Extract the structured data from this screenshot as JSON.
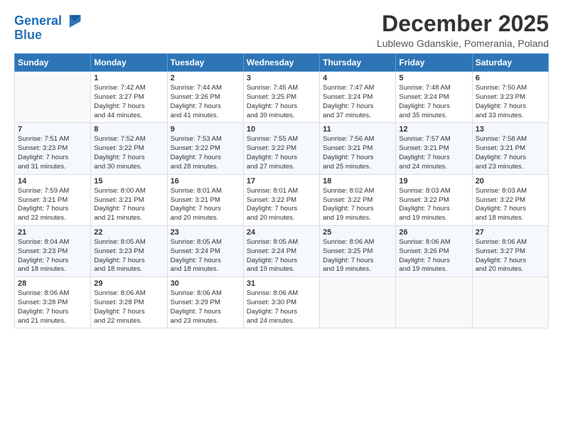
{
  "header": {
    "logo_line1": "General",
    "logo_line2": "Blue",
    "month": "December 2025",
    "location": "Lublewo Gdanskie, Pomerania, Poland"
  },
  "days_of_week": [
    "Sunday",
    "Monday",
    "Tuesday",
    "Wednesday",
    "Thursday",
    "Friday",
    "Saturday"
  ],
  "weeks": [
    [
      {
        "day": "",
        "info": ""
      },
      {
        "day": "1",
        "info": "Sunrise: 7:42 AM\nSunset: 3:27 PM\nDaylight: 7 hours\nand 44 minutes."
      },
      {
        "day": "2",
        "info": "Sunrise: 7:44 AM\nSunset: 3:26 PM\nDaylight: 7 hours\nand 41 minutes."
      },
      {
        "day": "3",
        "info": "Sunrise: 7:45 AM\nSunset: 3:25 PM\nDaylight: 7 hours\nand 39 minutes."
      },
      {
        "day": "4",
        "info": "Sunrise: 7:47 AM\nSunset: 3:24 PM\nDaylight: 7 hours\nand 37 minutes."
      },
      {
        "day": "5",
        "info": "Sunrise: 7:48 AM\nSunset: 3:24 PM\nDaylight: 7 hours\nand 35 minutes."
      },
      {
        "day": "6",
        "info": "Sunrise: 7:50 AM\nSunset: 3:23 PM\nDaylight: 7 hours\nand 33 minutes."
      }
    ],
    [
      {
        "day": "7",
        "info": "Sunrise: 7:51 AM\nSunset: 3:23 PM\nDaylight: 7 hours\nand 31 minutes."
      },
      {
        "day": "8",
        "info": "Sunrise: 7:52 AM\nSunset: 3:22 PM\nDaylight: 7 hours\nand 30 minutes."
      },
      {
        "day": "9",
        "info": "Sunrise: 7:53 AM\nSunset: 3:22 PM\nDaylight: 7 hours\nand 28 minutes."
      },
      {
        "day": "10",
        "info": "Sunrise: 7:55 AM\nSunset: 3:22 PM\nDaylight: 7 hours\nand 27 minutes."
      },
      {
        "day": "11",
        "info": "Sunrise: 7:56 AM\nSunset: 3:21 PM\nDaylight: 7 hours\nand 25 minutes."
      },
      {
        "day": "12",
        "info": "Sunrise: 7:57 AM\nSunset: 3:21 PM\nDaylight: 7 hours\nand 24 minutes."
      },
      {
        "day": "13",
        "info": "Sunrise: 7:58 AM\nSunset: 3:21 PM\nDaylight: 7 hours\nand 23 minutes."
      }
    ],
    [
      {
        "day": "14",
        "info": "Sunrise: 7:59 AM\nSunset: 3:21 PM\nDaylight: 7 hours\nand 22 minutes."
      },
      {
        "day": "15",
        "info": "Sunrise: 8:00 AM\nSunset: 3:21 PM\nDaylight: 7 hours\nand 21 minutes."
      },
      {
        "day": "16",
        "info": "Sunrise: 8:01 AM\nSunset: 3:21 PM\nDaylight: 7 hours\nand 20 minutes."
      },
      {
        "day": "17",
        "info": "Sunrise: 8:01 AM\nSunset: 3:22 PM\nDaylight: 7 hours\nand 20 minutes."
      },
      {
        "day": "18",
        "info": "Sunrise: 8:02 AM\nSunset: 3:22 PM\nDaylight: 7 hours\nand 19 minutes."
      },
      {
        "day": "19",
        "info": "Sunrise: 8:03 AM\nSunset: 3:22 PM\nDaylight: 7 hours\nand 19 minutes."
      },
      {
        "day": "20",
        "info": "Sunrise: 8:03 AM\nSunset: 3:22 PM\nDaylight: 7 hours\nand 18 minutes."
      }
    ],
    [
      {
        "day": "21",
        "info": "Sunrise: 8:04 AM\nSunset: 3:23 PM\nDaylight: 7 hours\nand 18 minutes."
      },
      {
        "day": "22",
        "info": "Sunrise: 8:05 AM\nSunset: 3:23 PM\nDaylight: 7 hours\nand 18 minutes."
      },
      {
        "day": "23",
        "info": "Sunrise: 8:05 AM\nSunset: 3:24 PM\nDaylight: 7 hours\nand 18 minutes."
      },
      {
        "day": "24",
        "info": "Sunrise: 8:05 AM\nSunset: 3:24 PM\nDaylight: 7 hours\nand 19 minutes."
      },
      {
        "day": "25",
        "info": "Sunrise: 8:06 AM\nSunset: 3:25 PM\nDaylight: 7 hours\nand 19 minutes."
      },
      {
        "day": "26",
        "info": "Sunrise: 8:06 AM\nSunset: 3:26 PM\nDaylight: 7 hours\nand 19 minutes."
      },
      {
        "day": "27",
        "info": "Sunrise: 8:06 AM\nSunset: 3:27 PM\nDaylight: 7 hours\nand 20 minutes."
      }
    ],
    [
      {
        "day": "28",
        "info": "Sunrise: 8:06 AM\nSunset: 3:28 PM\nDaylight: 7 hours\nand 21 minutes."
      },
      {
        "day": "29",
        "info": "Sunrise: 8:06 AM\nSunset: 3:28 PM\nDaylight: 7 hours\nand 22 minutes."
      },
      {
        "day": "30",
        "info": "Sunrise: 8:06 AM\nSunset: 3:29 PM\nDaylight: 7 hours\nand 23 minutes."
      },
      {
        "day": "31",
        "info": "Sunrise: 8:06 AM\nSunset: 3:30 PM\nDaylight: 7 hours\nand 24 minutes."
      },
      {
        "day": "",
        "info": ""
      },
      {
        "day": "",
        "info": ""
      },
      {
        "day": "",
        "info": ""
      }
    ]
  ]
}
